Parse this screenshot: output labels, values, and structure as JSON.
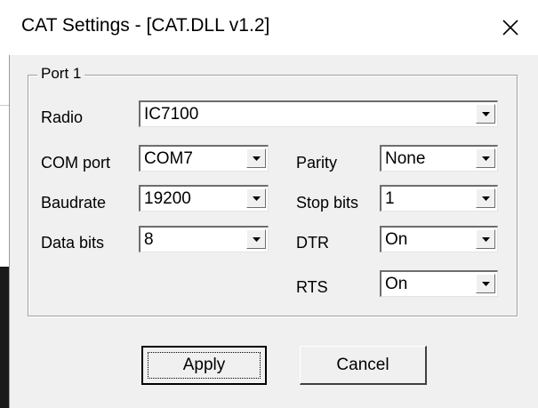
{
  "window": {
    "title": "CAT Settings - [CAT.DLL v1.2]"
  },
  "group": {
    "legend": "Port 1"
  },
  "fields": {
    "radio": {
      "label": "Radio",
      "value": "IC7100"
    },
    "com_port": {
      "label": "COM port",
      "value": "COM7"
    },
    "baudrate": {
      "label": "Baudrate",
      "value": "19200"
    },
    "data_bits": {
      "label": "Data bits",
      "value": "8"
    },
    "parity": {
      "label": "Parity",
      "value": "None"
    },
    "stop_bits": {
      "label": "Stop bits",
      "value": "1"
    },
    "dtr": {
      "label": "DTR",
      "value": "On"
    },
    "rts": {
      "label": "RTS",
      "value": "On"
    }
  },
  "buttons": {
    "apply": "Apply",
    "cancel": "Cancel"
  },
  "icons": {
    "close": "close-icon",
    "dropdown": "chevron-down-icon"
  },
  "colors": {
    "dialog_bg": "#f0f0f0",
    "field_bg": "#ffffff"
  }
}
